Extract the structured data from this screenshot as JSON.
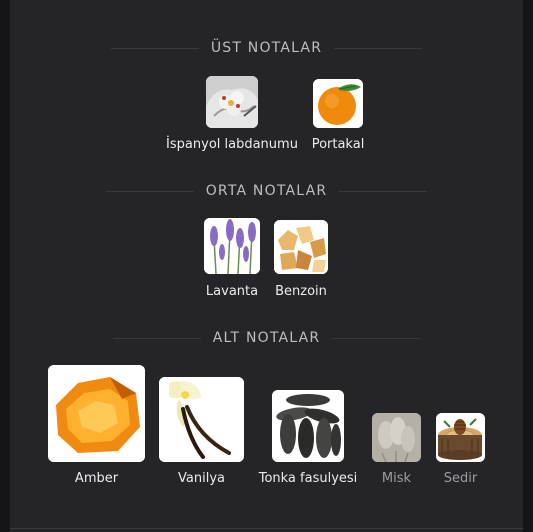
{
  "sections": [
    {
      "title": "ÜST NOTALAR",
      "notes": [
        {
          "label": "İspanyol labdanumu",
          "icon": "labdanum-flower-image"
        },
        {
          "label": "Portakal",
          "icon": "orange-image"
        }
      ]
    },
    {
      "title": "ORTA NOTALAR",
      "notes": [
        {
          "label": "Lavanta",
          "icon": "lavender-image"
        },
        {
          "label": "Benzoin",
          "icon": "benzoin-resin-image"
        }
      ]
    },
    {
      "title": "ALT NOTALAR",
      "notes": [
        {
          "label": "Amber",
          "icon": "amber-image"
        },
        {
          "label": "Vanilya",
          "icon": "vanilla-image"
        },
        {
          "label": "Tonka fasulyesi",
          "icon": "tonka-bean-image"
        },
        {
          "label": "Misk",
          "icon": "musk-image"
        },
        {
          "label": "Sedir",
          "icon": "cedar-image"
        }
      ]
    }
  ],
  "colors": {
    "background": "#141416",
    "panel": "#252528",
    "section_title": "#bdbdc2",
    "label": "#ececee",
    "label_dim": "#9c9ca3"
  }
}
